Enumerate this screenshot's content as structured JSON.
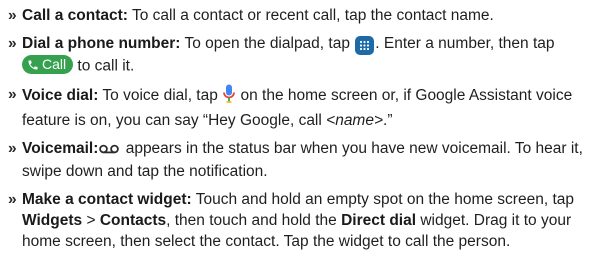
{
  "marker": "»",
  "items": [
    {
      "title": "Call a contact:",
      "text": " To call a contact or recent call, tap the contact name."
    },
    {
      "title": "Dial a phone number:",
      "text_before_icon": " To open the dialpad, tap ",
      "text_after_icon": ". Enter a number, then tap ",
      "call_button_label": "Call",
      "text_end": " to call it."
    },
    {
      "title": "Voice dial:",
      "text_before_icon": " To voice dial, tap ",
      "text_after_icon": " on the home screen or, if Google Assistant voice feature is on, you can say “Hey Google, call ",
      "placeholder": "<name>",
      "text_end": ".”"
    },
    {
      "title": "Voicemail:",
      "text_after_icon": " appears in the status bar when you have new voicemail. To hear it, swipe down and tap the notification."
    },
    {
      "title": "Make a contact widget:",
      "text_1": " Touch and hold an empty spot on the home screen, tap ",
      "widgets": "Widgets",
      "sep": " > ",
      "contacts": "Contacts",
      "text_2": ", then touch and hold the ",
      "direct_dial": "Direct dial",
      "text_3": " widget. Drag it to your home screen, then select the contact. Tap the widget to call the person."
    }
  ],
  "icons": {
    "dialpad_color": "#1c6aa8",
    "call_color": "#35a14f"
  }
}
